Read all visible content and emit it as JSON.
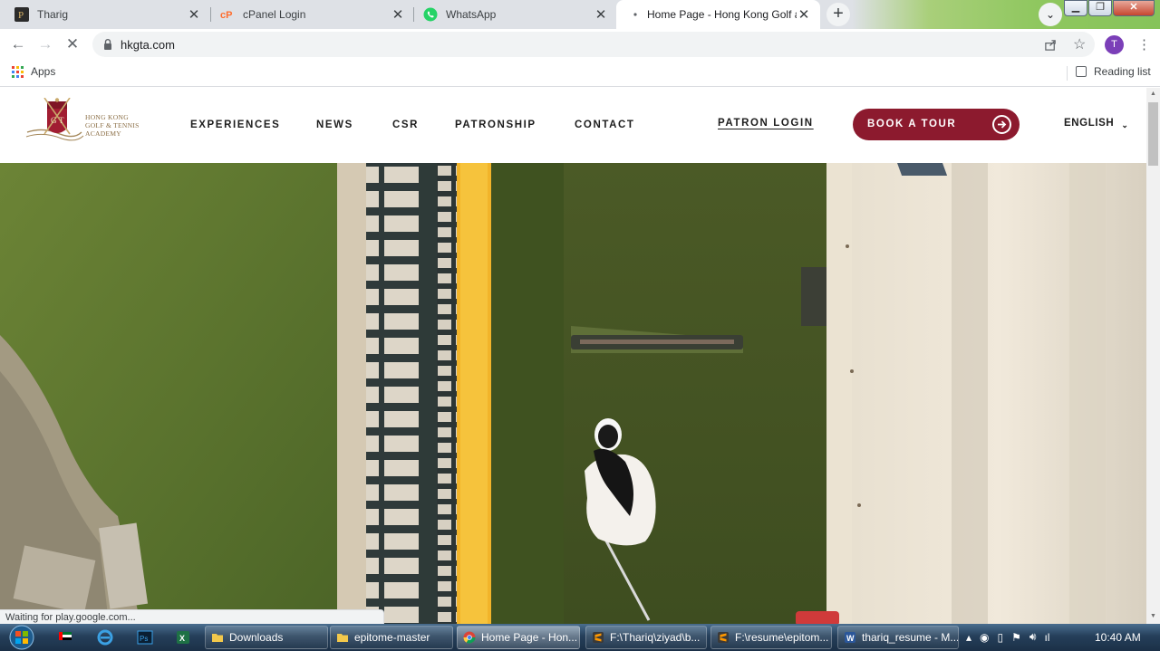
{
  "browser": {
    "tabs": [
      {
        "title": "Tharig",
        "favicon": "tharig-favicon"
      },
      {
        "title": "cPanel Login",
        "favicon": "cpanel-favicon"
      },
      {
        "title": "WhatsApp",
        "favicon": "whatsapp-favicon"
      },
      {
        "title": "Home Page - Hong Kong Golf an",
        "favicon": "loading-dot",
        "active": true
      }
    ],
    "address": "hkgta.com",
    "profile_initial": "T",
    "bookmarks": {
      "apps_label": "Apps",
      "reading_list_label": "Reading list"
    },
    "status_text": "Waiting for play.google.com..."
  },
  "site": {
    "logo": {
      "line1": "HONG KONG",
      "line2": "GOLF & TENNIS ACADEMY"
    },
    "nav": [
      "EXPERIENCES",
      "NEWS",
      "CSR",
      "PATRONSHIP",
      "CONTACT"
    ],
    "patron_login": "PATRON LOGIN",
    "book_tour": "BOOK A TOUR",
    "language": "ENGLISH",
    "accent_color": "#8c1a2e"
  },
  "taskbar": {
    "items": [
      {
        "label": "Downloads",
        "icon": "folder-icon"
      },
      {
        "label": "epitome-master",
        "icon": "folder-icon"
      },
      {
        "label": "Home Page - Hon...",
        "icon": "chrome-icon",
        "active": true
      },
      {
        "label": "F:\\Thariq\\ziyad\\b...",
        "icon": "sublime-icon"
      },
      {
        "label": "F:\\resume\\epitom...",
        "icon": "sublime-icon"
      },
      {
        "label": "thariq_resume - M...",
        "icon": "word-icon"
      }
    ],
    "clock": "10:40 AM"
  }
}
